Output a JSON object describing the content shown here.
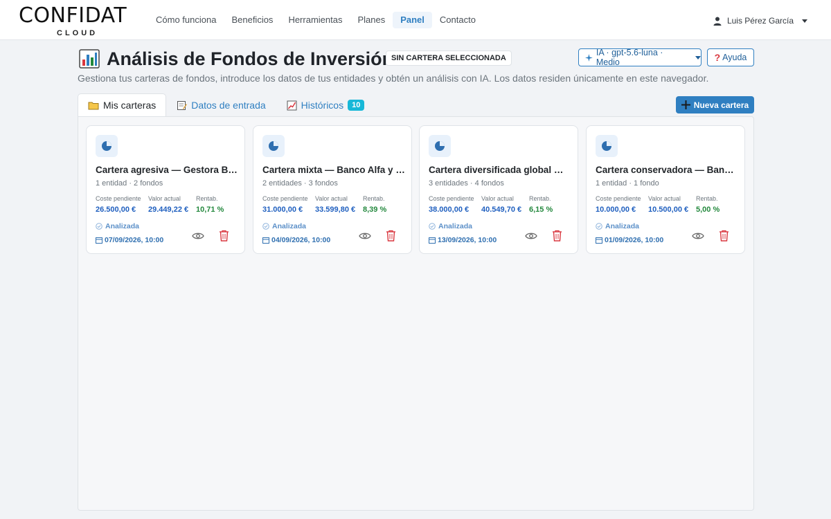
{
  "brand": {
    "name": "CONFIDAT",
    "sub": "CLOUD"
  },
  "nav": {
    "links": [
      "Cómo funciona",
      "Beneficios",
      "Herramientas",
      "Planes",
      "Panel",
      "Contacto"
    ],
    "active_index": 4,
    "user": "Luis Pérez García"
  },
  "header": {
    "title": "Análisis de Fondos de Inversión",
    "badge": "SIN CARTERA SELECCIONADA",
    "model_label": "IA · gpt-5.6-luna · Medio",
    "help_label": "Ayuda",
    "subtitle": "Gestiona tus carteras de fondos, introduce los datos de tus entidades y obtén un análisis con IA. Los datos residen únicamente en este navegador."
  },
  "tabs": [
    {
      "label": "Mis carteras",
      "icon": "folder-icon"
    },
    {
      "label": "Datos de entrada",
      "icon": "memo-icon"
    },
    {
      "label": "Históricos",
      "icon": "chart-line-icon",
      "count": "10"
    }
  ],
  "new_portfolio_label": "Nueva cartera",
  "card_labels": {
    "cost": "Coste pendiente",
    "value": "Valor actual",
    "return": "Rentab."
  },
  "cards": [
    {
      "title": "Cartera agresiva — Gestora Beta",
      "meta": "1 entidad · 2 fondos",
      "cost": "26.500,00 €",
      "value": "29.449,22 €",
      "return": "10,71 %",
      "status": "Analizada",
      "date": "07/09/2026, 10:00"
    },
    {
      "title": "Cartera mixta — Banco Alfa y …",
      "meta": "2 entidades · 3 fondos",
      "cost": "31.000,00 €",
      "value": "33.599,80 €",
      "return": "8,39 %",
      "status": "Analizada",
      "date": "04/09/2026, 10:00"
    },
    {
      "title": "Cartera diversificada global — …",
      "meta": "3 entidades · 4 fondos",
      "cost": "38.000,00 €",
      "value": "40.549,70 €",
      "return": "6,15 %",
      "status": "Analizada",
      "date": "13/09/2026, 10:00"
    },
    {
      "title": "Cartera conservadora — Banco…",
      "meta": "1 entidad · 1 fondo",
      "cost": "10.000,00 €",
      "value": "10.500,00 €",
      "return": "5,00 %",
      "status": "Analizada",
      "date": "01/09/2026, 10:00"
    }
  ],
  "colors": {
    "primary": "#2f7fc1",
    "success": "#23883d",
    "danger": "#d9363e",
    "info_badge": "#17b8d8"
  }
}
